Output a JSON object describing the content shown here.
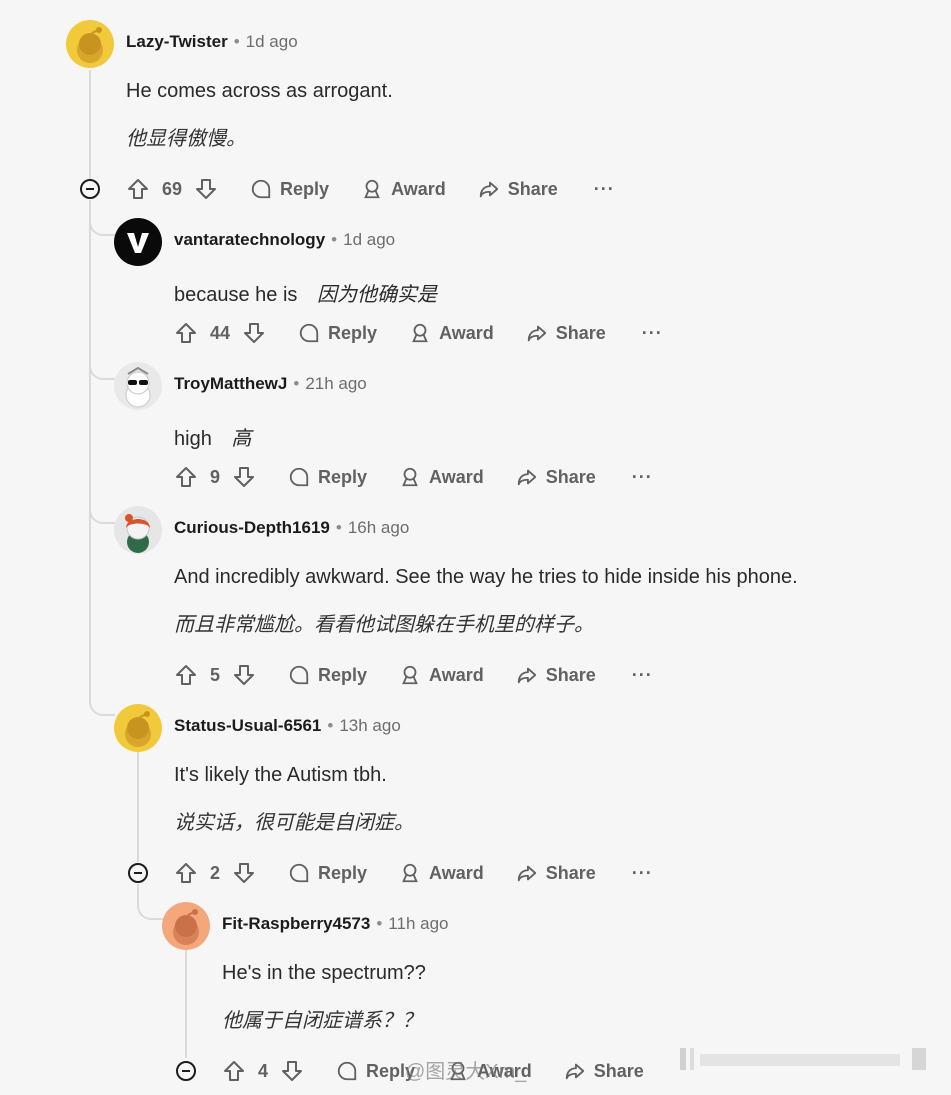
{
  "comments": [
    {
      "user": "Lazy-Twister",
      "time": "1d ago",
      "text": "He comes across as arrogant.",
      "translation": "他显得傲慢。",
      "votes": "69"
    },
    {
      "user": "vantaratechnology",
      "time": "1d ago",
      "text": "because he is",
      "translation": "因为他确实是",
      "votes": "44"
    },
    {
      "user": "TroyMatthewJ",
      "time": "21h ago",
      "text": "high",
      "translation": "高",
      "votes": "9"
    },
    {
      "user": "Curious-Depth1619",
      "time": "16h ago",
      "text": "And incredibly awkward. See the way he tries to hide inside his phone.",
      "translation": "而且非常尴尬。看看他试图躲在手机里的样子。",
      "votes": "5"
    },
    {
      "user": "Status-Usual-6561",
      "time": "13h ago",
      "text": "It's likely the Autism tbh.",
      "translation": "说实话，很可能是自闭症。",
      "votes": "2"
    },
    {
      "user": "Fit-Raspberry4573",
      "time": "11h ago",
      "text": "He's in the spectrum??",
      "translation": "他属于自闭症谱系？？",
      "votes": "4"
    }
  ],
  "labels": {
    "reply": "Reply",
    "award": "Award",
    "share": "Share",
    "more": "···",
    "sep": "•"
  },
  "watermark": "@图灵大Xm_",
  "colors": {
    "background": "#f6f6f6",
    "thread": "#d9dadc",
    "avatar_yellow": "#f1c93b",
    "avatar_orange": "#f4a77a"
  }
}
